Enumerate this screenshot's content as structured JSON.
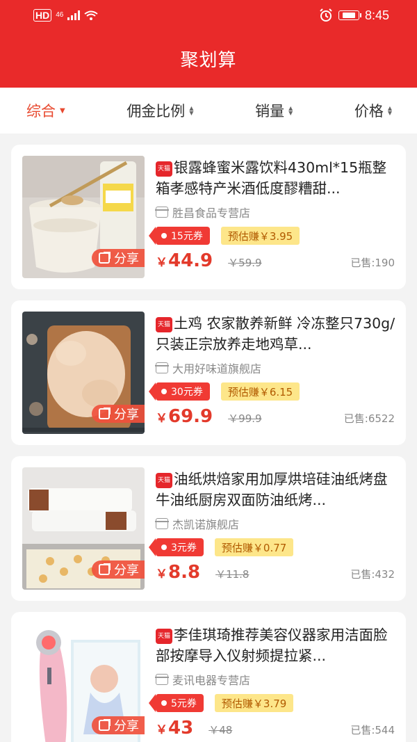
{
  "status_bar": {
    "left_badge": "HD",
    "network": "46",
    "time": "8:45"
  },
  "header": {
    "title": "聚划算"
  },
  "filters": [
    {
      "label": "综合",
      "active": true
    },
    {
      "label": "佣金比例",
      "active": false
    },
    {
      "label": "销量",
      "active": false
    },
    {
      "label": "价格",
      "active": false
    }
  ],
  "products": [
    {
      "tag": "天猫",
      "name": "银露蜂蜜米露饮料430ml*15瓶整箱孝感特产米酒低度醪糟甜...",
      "shop": "胜昌食品专营店",
      "coupon": "15元券",
      "earn": "预估赚￥3.95",
      "yen": "￥",
      "price": "44.9",
      "original_price": "￥59.9",
      "sold": "已售:190",
      "share": "分享"
    },
    {
      "tag": "天猫",
      "name": "土鸡 农家散养新鲜 冷冻整只730g/只装正宗放养走地鸡草...",
      "shop": "大用好味道旗舰店",
      "coupon": "30元券",
      "earn": "预估赚￥6.15",
      "yen": "￥",
      "price": "69.9",
      "original_price": "￥99.9",
      "sold": "已售:6522",
      "share": "分享"
    },
    {
      "tag": "天猫",
      "name": "油纸烘焙家用加厚烘培硅油纸烤盘牛油纸厨房双面防油纸烤...",
      "shop": "杰凯诺旗舰店",
      "coupon": "3元券",
      "earn": "预估赚￥0.77",
      "yen": "￥",
      "price": "8.8",
      "original_price": "￥11.8",
      "sold": "已售:432",
      "share": "分享"
    },
    {
      "tag": "天猫",
      "name": "李佳琪琦推荐美容仪器家用洁面脸部按摩导入仪射频提拉紧...",
      "shop": "麦讯电器专营店",
      "coupon": "5元券",
      "earn": "预估赚￥3.79",
      "yen": "￥",
      "price": "43",
      "original_price": "￥48",
      "sold": "已售:544",
      "share": "分享"
    }
  ],
  "icons": {
    "sort": "sort-updown-icon",
    "share": "share-icon",
    "shop": "shop-icon",
    "alarm": "alarm-icon",
    "battery": "battery-icon",
    "wifi": "wifi-icon",
    "signal": "signal-icon"
  },
  "colors": {
    "header_bg": "#e92a2a",
    "price": "#e33a2b",
    "coupon": "#f03a34",
    "earn_bg": "#fde68a",
    "active_filter": "#e8492f"
  }
}
